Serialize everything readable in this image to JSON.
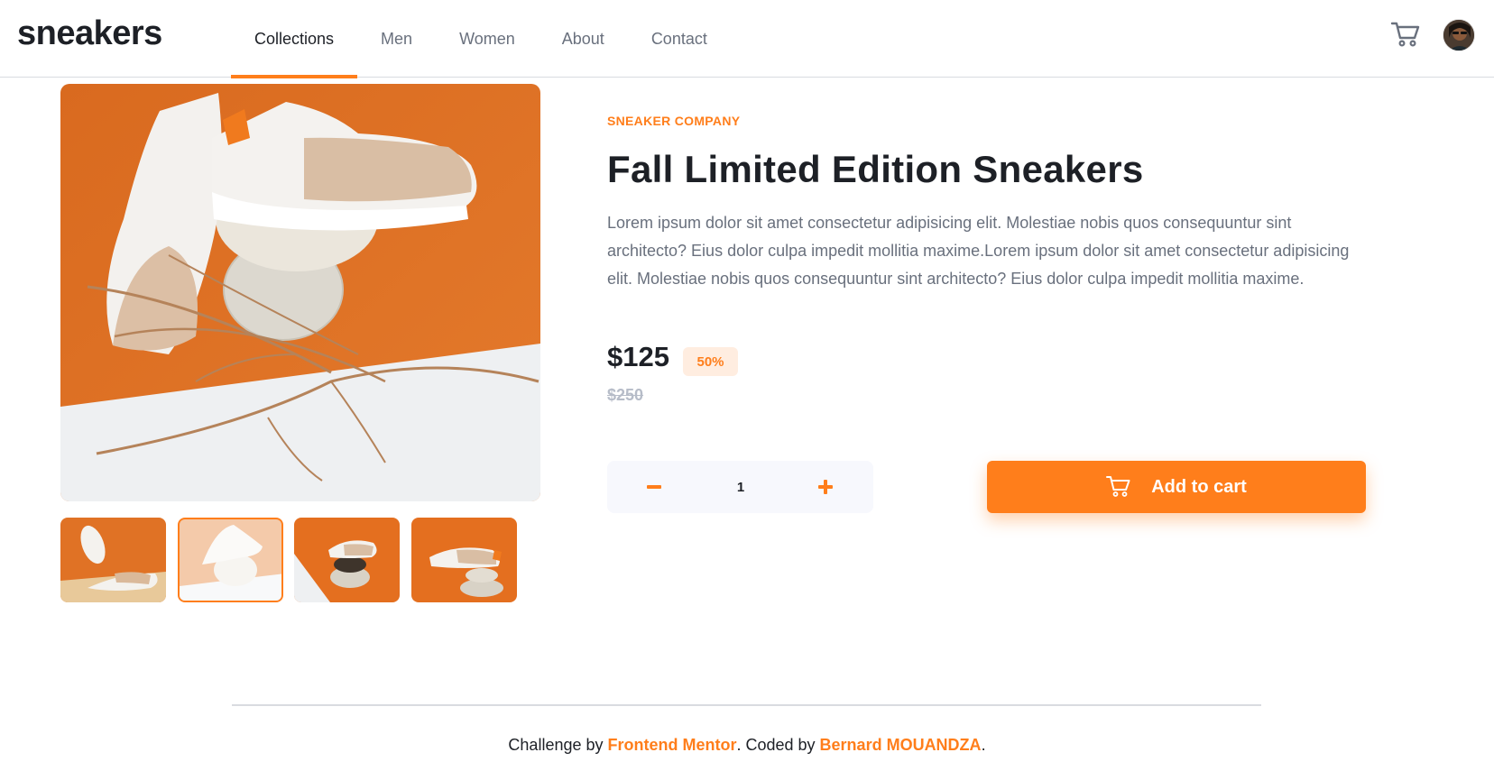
{
  "header": {
    "logo": "sneakers",
    "nav": [
      "Collections",
      "Men",
      "Women",
      "About",
      "Contact"
    ],
    "active_nav": "Collections"
  },
  "gallery": {
    "thumbnails": [
      "thumbnail-1",
      "thumbnail-2",
      "thumbnail-3",
      "thumbnail-4"
    ],
    "active_thumbnail_index": 1
  },
  "product": {
    "company": "SNEAKER COMPANY",
    "title": "Fall Limited Edition Sneakers",
    "description": "Lorem ipsum dolor sit amet consectetur adipisicing elit. Molestiae nobis quos consequuntur sint architecto? Eius dolor culpa impedit mollitia maxime.Lorem ipsum dolor sit amet consectetur adipisicing elit. Molestiae nobis quos consequuntur sint architecto? Eius dolor culpa impedit mollitia maxime.",
    "price": "$125",
    "discount": "50%",
    "old_price": "$250",
    "quantity": "1",
    "add_to_cart": "Add to cart"
  },
  "footer": {
    "prefix": "Challenge by ",
    "link1": "Frontend Mentor",
    "middle": ". Coded by ",
    "link2": "Bernard MOUANDZA",
    "suffix": "."
  },
  "colors": {
    "accent": "#ff7e1b",
    "accent_pale": "#ffede0",
    "text_dark": "#1d2026",
    "text_gray": "#69707d"
  }
}
